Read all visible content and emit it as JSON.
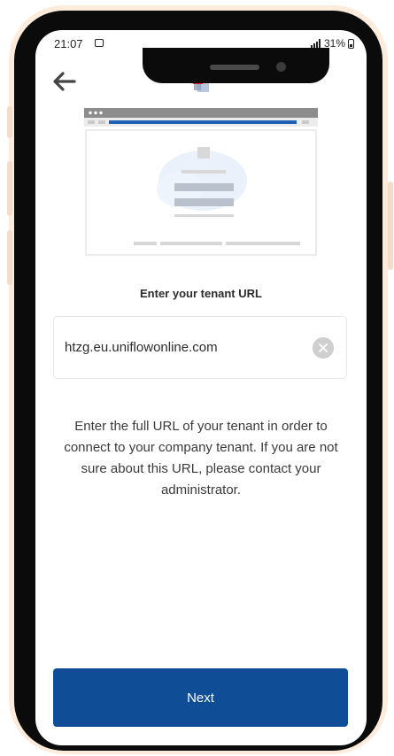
{
  "status_bar": {
    "time": "21:07",
    "battery": "31%"
  },
  "header": {
    "back_icon": "arrow-left-icon",
    "logo_icon": "app-logo-icon"
  },
  "main": {
    "prompt_title": "Enter your tenant URL",
    "url_field": {
      "value": "htzg.eu.uniflowonline.com",
      "clear_icon": "clear-circle-icon"
    },
    "help_text": "Enter the full URL of your tenant in order to connect to your company tenant. If you are not sure about this URL, please contact your administrator.",
    "next_label": "Next"
  },
  "colors": {
    "primary": "#0f4d96",
    "logo_red": "#e0202a",
    "illustration_blue": "#1f5fb5"
  }
}
